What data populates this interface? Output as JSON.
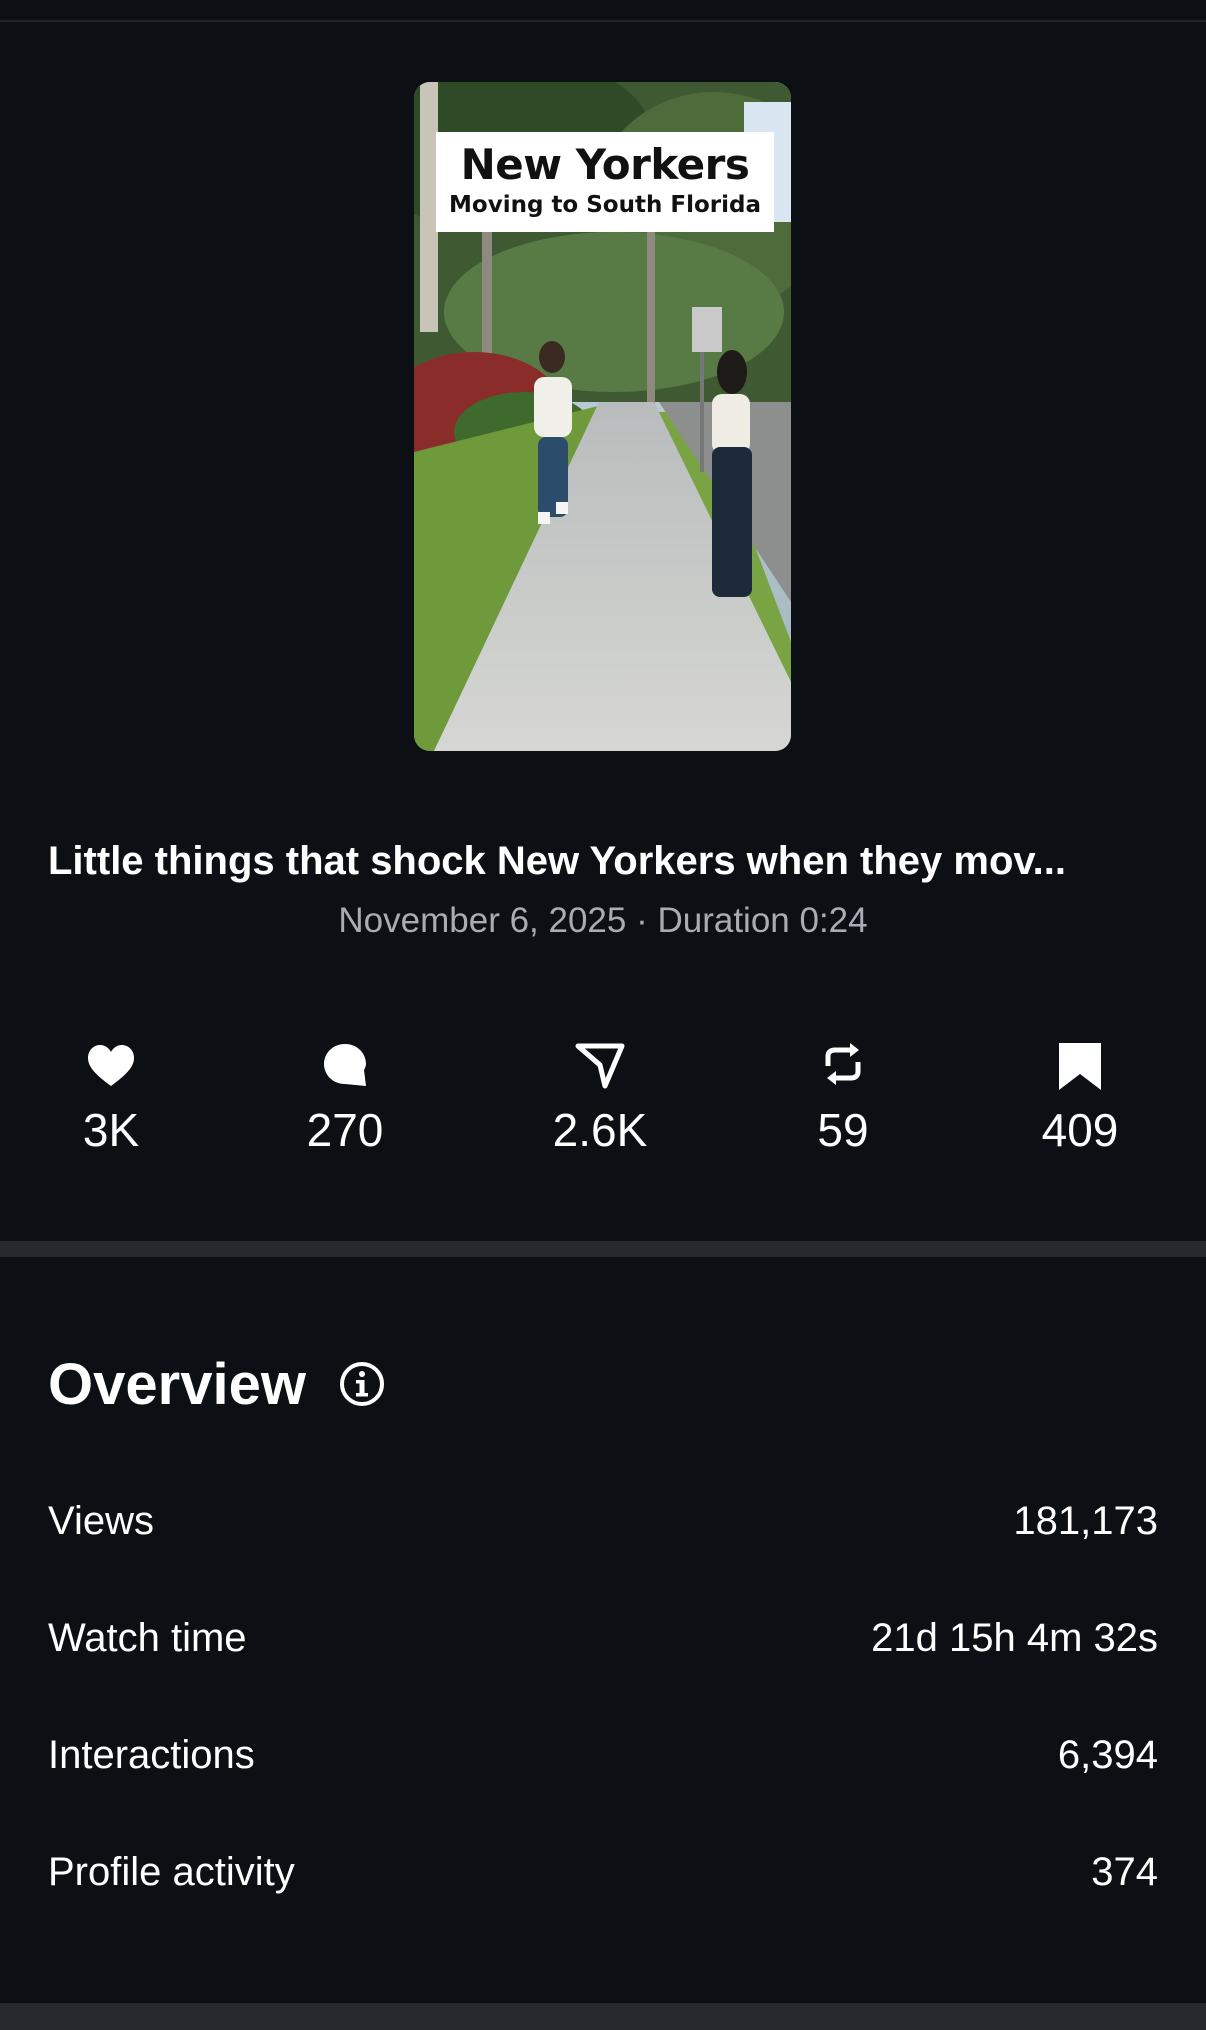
{
  "thumbnail": {
    "caption_title": "New Yorkers",
    "caption_subtitle": "Moving to South Florida"
  },
  "video": {
    "title": "Little things that shock New Yorkers when they mov...",
    "meta": "November 6, 2025 · Duration 0:24"
  },
  "stats": [
    {
      "icon": "heart-icon",
      "value": "3K"
    },
    {
      "icon": "comment-icon",
      "value": "270"
    },
    {
      "icon": "share-icon",
      "value": "2.6K"
    },
    {
      "icon": "repost-icon",
      "value": "59"
    },
    {
      "icon": "bookmark-icon",
      "value": "409"
    }
  ],
  "overview": {
    "heading": "Overview",
    "info_icon": "info-icon",
    "rows": [
      {
        "label": "Views",
        "value": "181,173"
      },
      {
        "label": "Watch time",
        "value": "21d 15h 4m 32s"
      },
      {
        "label": "Interactions",
        "value": "6,394"
      },
      {
        "label": "Profile activity",
        "value": "374"
      }
    ]
  },
  "colors": {
    "background": "#0c1014",
    "divider": "#26292e",
    "meta_text": "#a8adb3",
    "text": "#ffffff"
  }
}
